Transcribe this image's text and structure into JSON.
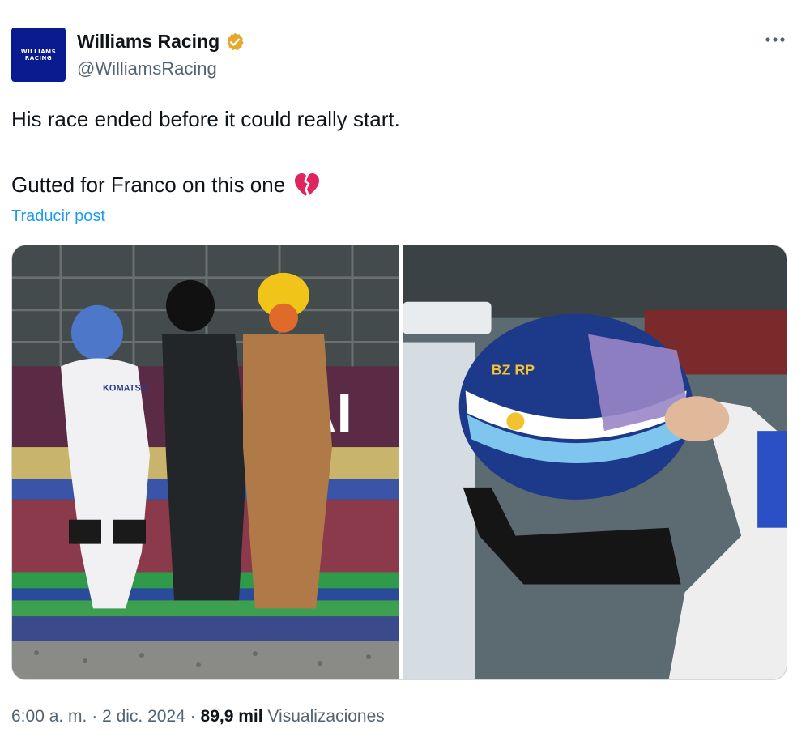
{
  "author": {
    "name": "Williams Racing",
    "handle": "@WilliamsRacing",
    "avatar_text": [
      "WILLIAMS",
      "RACING"
    ],
    "verified": true,
    "verified_color": "#e6a92b"
  },
  "tweet": {
    "text_line1": "His race ended before it could really start.",
    "text_line2": "Gutted for Franco on this one",
    "emoji": "broken-heart-icon",
    "translate_label": "Traducir post"
  },
  "media": {
    "left": {
      "description_icon": "photo-track-marshals",
      "banner_text": "AI",
      "suit_text": "KOMATSU"
    },
    "right": {
      "description_icon": "photo-helmet",
      "helmet_text": "BZ RP"
    }
  },
  "meta": {
    "time": "6:00 a. m.",
    "separator": "·",
    "date": "2 dic. 2024",
    "views_count": "89,9 mil",
    "views_label": "Visualizaciones"
  },
  "colors": {
    "link": "#1d9bf0",
    "secondary_text": "#536471",
    "brand": "#0a1a8f"
  }
}
